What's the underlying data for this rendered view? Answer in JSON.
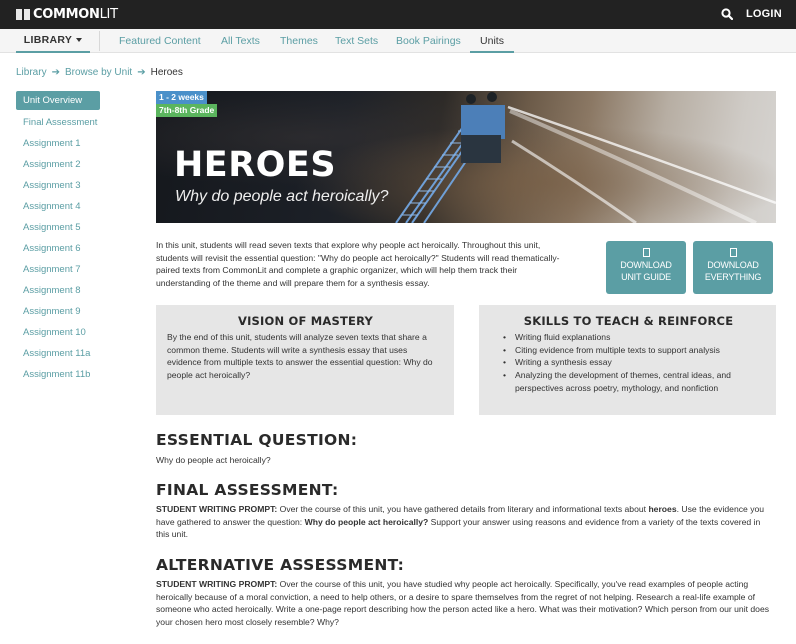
{
  "topbar": {
    "brand_bold": "COMMON",
    "brand_light": "LIT",
    "search_icon": "search-icon",
    "login_label": "LOGIN"
  },
  "nav": {
    "library_label": "LIBRARY",
    "items": [
      {
        "label": "Featured Content",
        "active": false
      },
      {
        "label": "All Texts",
        "active": false
      },
      {
        "label": "Themes",
        "active": false
      },
      {
        "label": "Text Sets",
        "active": false
      },
      {
        "label": "Book Pairings",
        "active": false
      },
      {
        "label": "Units",
        "active": true
      }
    ]
  },
  "breadcrumb": {
    "items": [
      "Library",
      "Browse by Unit"
    ],
    "current": "Heroes"
  },
  "sidebar": {
    "items": [
      {
        "label": "Unit Overview",
        "active": true
      },
      {
        "label": "Final Assessment"
      },
      {
        "label": "Assignment 1"
      },
      {
        "label": "Assignment 2"
      },
      {
        "label": "Assignment 3"
      },
      {
        "label": "Assignment 4"
      },
      {
        "label": "Assignment 5"
      },
      {
        "label": "Assignment 6"
      },
      {
        "label": "Assignment 7"
      },
      {
        "label": "Assignment 8"
      },
      {
        "label": "Assignment 9"
      },
      {
        "label": "Assignment 10"
      },
      {
        "label": "Assignment 11a"
      },
      {
        "label": "Assignment 11b"
      }
    ]
  },
  "hero": {
    "duration_badge": "1 - 2 weeks",
    "grade_badge": "7th-8th Grade",
    "title": "HEROES",
    "subtitle": "Why do people act heroically?"
  },
  "intro": "In this unit, students will read seven texts that explore why people act heroically. Throughout this unit, students will revisit the essential question: \"Why do people act heroically?\" Students will read thematically-paired texts from CommonLit and complete a graphic organizer, which will help them track their understanding of the theme and will prepare them for a synthesis essay.",
  "downloads": {
    "guide_line1": "DOWNLOAD",
    "guide_line2": "UNIT GUIDE",
    "everything_line1": "DOWNLOAD",
    "everything_line2": "EVERYTHING"
  },
  "vision": {
    "title": "VISION OF MASTERY",
    "text": "By the end of this unit, students will analyze seven texts that share a common theme. Students will write a synthesis essay that uses evidence from multiple texts to answer the essential question: Why do people act heroically?"
  },
  "skills": {
    "title": "SKILLS TO TEACH & REINFORCE",
    "items": [
      "Writing fluid explanations",
      "Citing evidence from multiple texts to support analysis",
      "Writing a synthesis essay",
      "Analyzing the development of themes, central ideas, and perspectives across poetry, mythology, and nonfiction"
    ]
  },
  "essential_question": {
    "heading": "ESSENTIAL QUESTION:",
    "text": "Why do people act heroically?"
  },
  "final_assessment": {
    "heading": "FINAL ASSESSMENT:",
    "prompt_label": "STUDENT WRITING PROMPT:",
    "text_a": " Over the course of this unit, you have gathered details from literary and informational texts about ",
    "bold_a": "heroes",
    "text_b": ". Use the evidence you have gathered to answer the question: ",
    "bold_b": "Why do people act heroically?",
    "text_c": " Support your answer using reasons and evidence from a variety of the texts covered in this unit."
  },
  "alternative_assessment": {
    "heading": "ALTERNATIVE ASSESSMENT:",
    "prompt_label": "STUDENT WRITING PROMPT:",
    "text": " Over the course of this unit, you have studied why people act heroically. Specifically, you've read examples of people acting heroically because of a moral conviction, a need to help others, or a desire to spare themselves from the regret of not helping. Research a real-life example of someone who acted heroically. Write a one-page report describing how the person acted like a hero. What was their motivation? Which person from our unit does your chosen hero most closely resemble? Why?"
  },
  "colors": {
    "accent": "#5b9ea4",
    "topbar": "#222222",
    "box_bg": "#e6e6e6",
    "badge_duration": "#4a90c9",
    "badge_grade": "#5bb55e"
  }
}
